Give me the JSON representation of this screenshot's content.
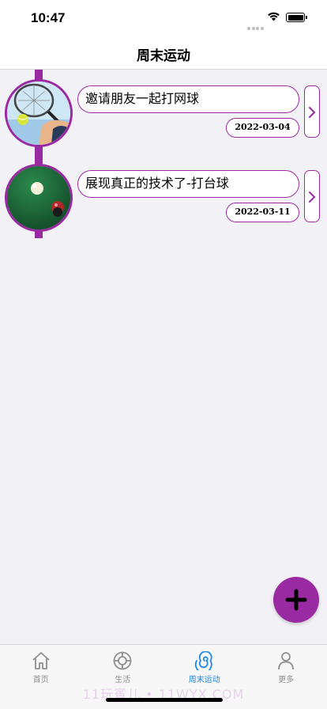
{
  "status_bar": {
    "time": "10:47"
  },
  "nav": {
    "title": "周末运动"
  },
  "activities": [
    {
      "title": "邀请朋友一起打网球",
      "date": "2022-03-04",
      "image": "tennis-photo"
    },
    {
      "title": "展现真正的技术了-打台球",
      "date": "2022-03-11",
      "image": "billiards-photo"
    }
  ],
  "fab": {
    "icon": "plus-icon"
  },
  "tabs": [
    {
      "label": "首页",
      "icon": "home-icon",
      "active": false
    },
    {
      "label": "生活",
      "icon": "life-ring-icon",
      "active": false
    },
    {
      "label": "周末运动",
      "icon": "sport-spiral-icon",
      "active": true
    },
    {
      "label": "更多",
      "icon": "person-icon",
      "active": false
    }
  ],
  "watermark": "11玩賓儿 • 11WYX.COM",
  "colors": {
    "accent": "#9a2aa2",
    "tab_active": "#1e88e5",
    "tab_inactive": "#8e8e93"
  }
}
